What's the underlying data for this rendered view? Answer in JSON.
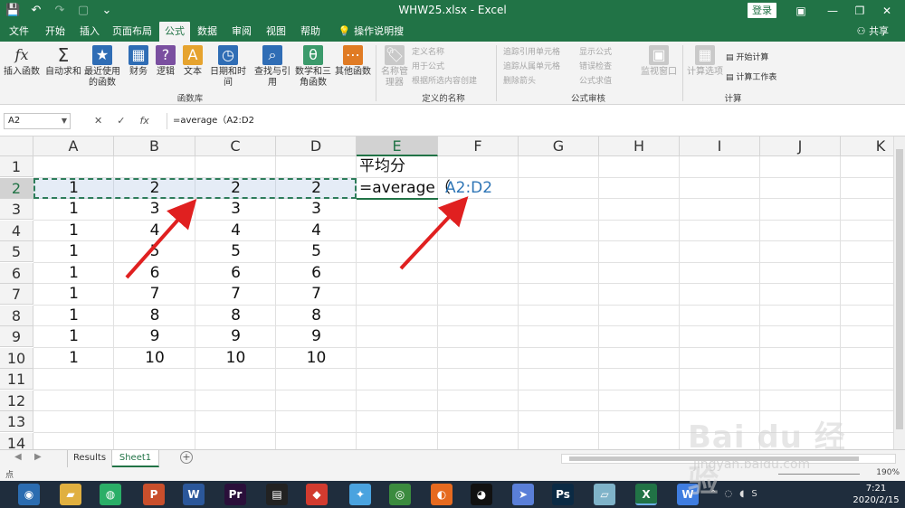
{
  "titlebar": {
    "doc_title": "WHW25.xlsx  -  Excel",
    "login": "登录",
    "qat": [
      "💾",
      "↶",
      "↷",
      "▢",
      "⌄"
    ]
  },
  "tabs": [
    "文件",
    "开始",
    "插入",
    "页面布局",
    "公式",
    "数据",
    "审阅",
    "视图",
    "帮助",
    "操作说明搜索"
  ],
  "active_tab": "公式",
  "share": "共享",
  "ribbon": {
    "functions": [
      {
        "label": "插入函数",
        "icon": "fx"
      },
      {
        "label": "自动求和",
        "icon": "Σ"
      },
      {
        "label": "最近使用的函数",
        "icon": "★"
      },
      {
        "label": "财务",
        "icon": "▦"
      },
      {
        "label": "逻辑",
        "icon": "?"
      },
      {
        "label": "文本",
        "icon": "A"
      },
      {
        "label": "日期和时间",
        "icon": "◷"
      },
      {
        "label": "查找与引用",
        "icon": "⌕"
      },
      {
        "label": "数学和三角函数",
        "icon": "θ"
      },
      {
        "label": "其他函数",
        "icon": "⋯"
      }
    ],
    "group_function_library": "函数库",
    "name_manager": "名称管理器",
    "defined_names": [
      "定义名称",
      "用于公式",
      "根据所选内容创建"
    ],
    "group_defined_names": "定义的名称",
    "audit": [
      "追踪引用单元格",
      "追踪从属单元格",
      "删除箭头",
      "显示公式",
      "错误检查",
      "公式求值"
    ],
    "watch_window": "监视窗口",
    "group_audit": "公式审核",
    "calc_options": "计算选项",
    "calc_now": "开始计算",
    "calc_sheet": "计算工作表",
    "group_calc": "计算"
  },
  "formula_bar": {
    "name_box": "A2",
    "formula": "=average（A2:D2"
  },
  "columns": [
    "A",
    "B",
    "C",
    "D",
    "E",
    "F",
    "G",
    "H",
    "I",
    "J",
    "K"
  ],
  "rows": [
    "1",
    "2",
    "3",
    "4",
    "5",
    "6",
    "7",
    "8",
    "9",
    "10",
    "11",
    "12",
    "13",
    "14"
  ],
  "cells": {
    "e1": "平均分",
    "e2": "=average（",
    "e2_ref": "A2:D2",
    "data": [
      [
        "1",
        "2",
        "2",
        "2"
      ],
      [
        "1",
        "3",
        "3",
        "3"
      ],
      [
        "1",
        "4",
        "4",
        "4"
      ],
      [
        "1",
        "5",
        "5",
        "5"
      ],
      [
        "1",
        "6",
        "6",
        "6"
      ],
      [
        "1",
        "7",
        "7",
        "7"
      ],
      [
        "1",
        "8",
        "8",
        "8"
      ],
      [
        "1",
        "9",
        "9",
        "9"
      ],
      [
        "1",
        "10",
        "10",
        "10"
      ]
    ]
  },
  "sheets": [
    "Results",
    "Sheet1"
  ],
  "active_sheet": "Sheet1",
  "status": {
    "mode": "点",
    "zoom": "190%"
  },
  "taskbar": {
    "time": "7:21",
    "date": "2020/2/15",
    "apps": [
      {
        "name": "browser",
        "glyph": "◉",
        "color": "#2b6cb0"
      },
      {
        "name": "explorer",
        "glyph": "▰",
        "color": "#e0b040"
      },
      {
        "name": "wechat",
        "glyph": "◍",
        "color": "#2aae67"
      },
      {
        "name": "powerpoint",
        "glyph": "P",
        "color": "#c94f2c"
      },
      {
        "name": "word",
        "glyph": "W",
        "color": "#2b579a"
      },
      {
        "name": "premiere",
        "glyph": "Pr",
        "color": "#2a0f3a"
      },
      {
        "name": "video",
        "glyph": "▤",
        "color": "#222222"
      },
      {
        "name": "app-red",
        "glyph": "◆",
        "color": "#d23b2f"
      },
      {
        "name": "app-bird",
        "glyph": "✦",
        "color": "#4aa3df"
      },
      {
        "name": "chrome",
        "glyph": "◎",
        "color": "#3b8b3e"
      },
      {
        "name": "firefox",
        "glyph": "◐",
        "color": "#e66a1f"
      },
      {
        "name": "qq",
        "glyph": "◕",
        "color": "#111111"
      },
      {
        "name": "app-blue",
        "glyph": "➤",
        "color": "#5a7fd8"
      },
      {
        "name": "photoshop",
        "glyph": "Ps",
        "color": "#0b2a44"
      },
      {
        "name": "app-eraser",
        "glyph": "▱",
        "color": "#7fb3c9"
      },
      {
        "name": "excel",
        "glyph": "X",
        "color": "#217346"
      },
      {
        "name": "wps",
        "glyph": "W",
        "color": "#3f7de0"
      }
    ]
  },
  "watermark": {
    "text": "Bai du 经验",
    "url": "jingyan.baidu.com"
  },
  "colors": {
    "excel_green": "#217346",
    "ref_blue": "#2e75b6",
    "arrow_red": "#e02020"
  }
}
